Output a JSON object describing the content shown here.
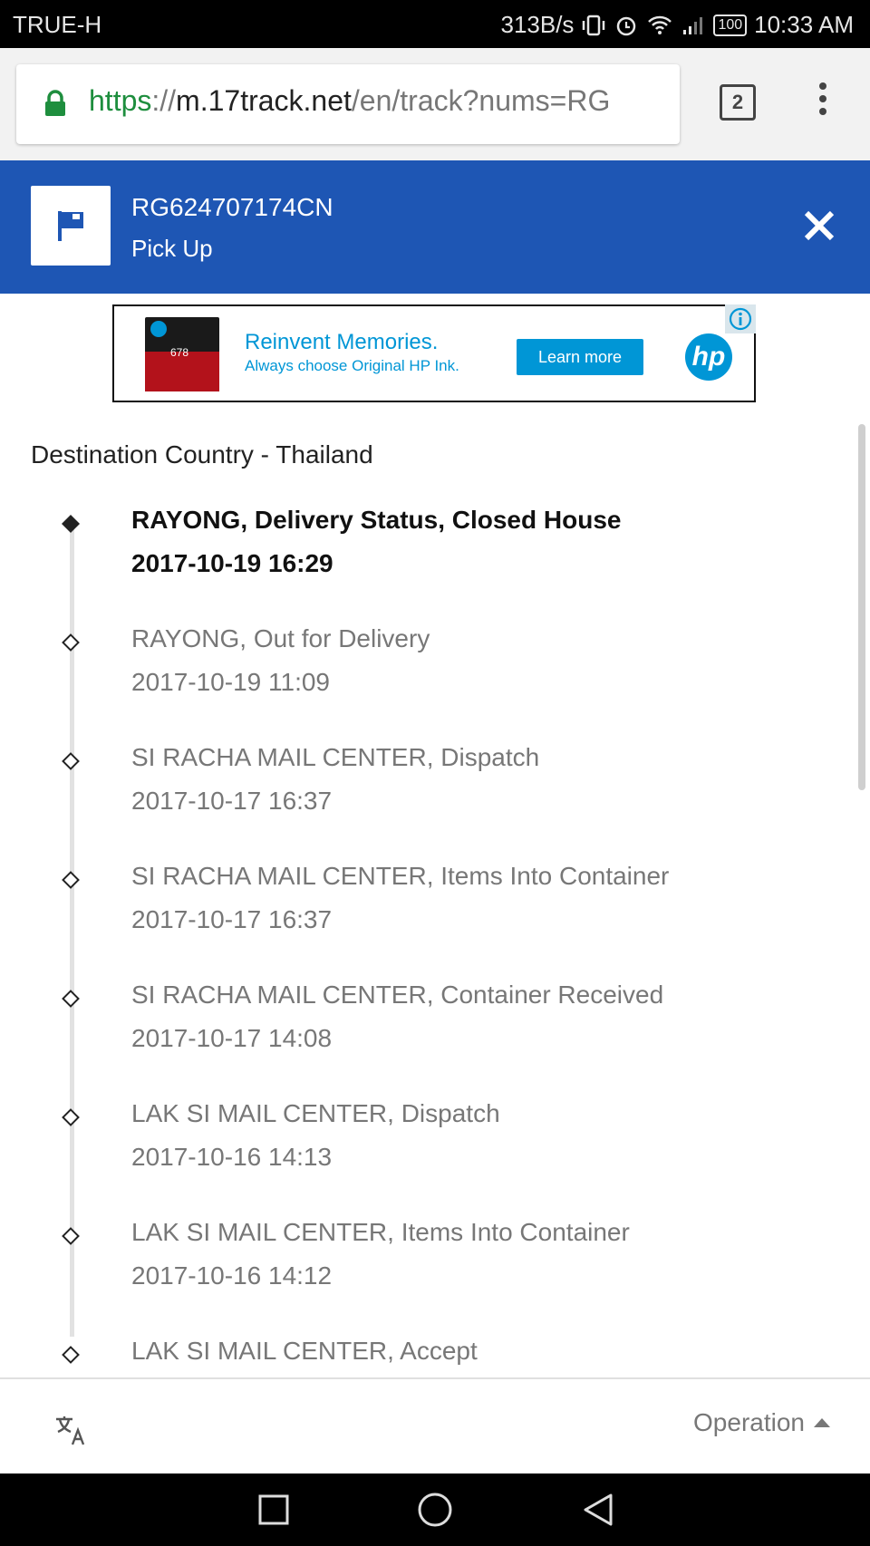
{
  "status_bar": {
    "carrier": "TRUE-H",
    "net_speed": "313B/s",
    "battery": "100",
    "time": "10:33 AM"
  },
  "browser": {
    "url_scheme": "https",
    "url_sep": "://",
    "url_host": "m.17track.net",
    "url_path": "/en/track?nums=RG",
    "tab_count": "2"
  },
  "tracking": {
    "number": "RG624707174CN",
    "status": "Pick Up"
  },
  "ad": {
    "product_num": "678",
    "headline": "Reinvent Memories.",
    "subline": "Always choose Original HP Ink.",
    "cta": "Learn more",
    "brand": "hp"
  },
  "destination": "Destination Country - Thailand",
  "events": [
    {
      "location": "RAYONG, Delivery Status, Closed House",
      "time": "2017-10-19 16:29"
    },
    {
      "location": "RAYONG, Out for Delivery",
      "time": "2017-10-19 11:09"
    },
    {
      "location": "SI RACHA MAIL CENTER, Dispatch",
      "time": "2017-10-17 16:37"
    },
    {
      "location": "SI RACHA MAIL CENTER, Items Into Container",
      "time": "2017-10-17 16:37"
    },
    {
      "location": "SI RACHA MAIL CENTER, Container Received",
      "time": "2017-10-17 14:08"
    },
    {
      "location": "LAK SI MAIL CENTER, Dispatch",
      "time": "2017-10-16 14:13"
    },
    {
      "location": "LAK SI MAIL CENTER, Items Into Container",
      "time": "2017-10-16 14:12"
    },
    {
      "location": "LAK SI MAIL CENTER, Accept",
      "time": ""
    }
  ],
  "bottom_bar": {
    "operation_label": "Operation"
  },
  "icons": {
    "lock": "lock-icon",
    "flag": "flag-icon",
    "close": "close-icon",
    "translate": "translate-icon",
    "info": "info-icon"
  }
}
